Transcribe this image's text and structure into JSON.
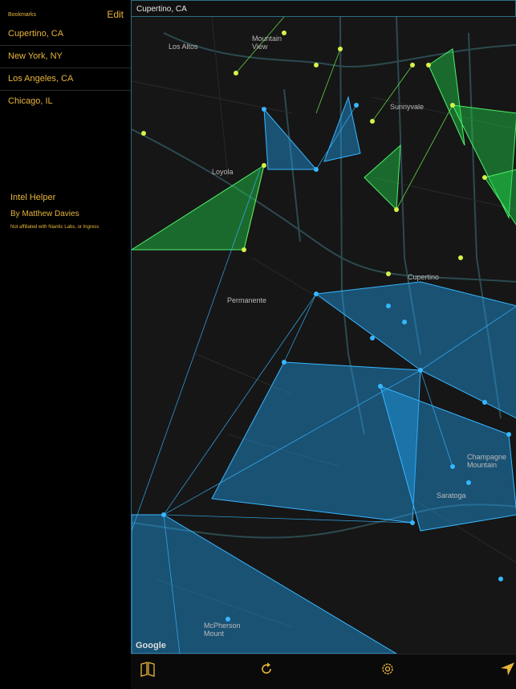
{
  "sidebar": {
    "title": "Bookmarks",
    "edit_label": "Edit",
    "bookmarks": [
      {
        "label": "Cupertino, CA"
      },
      {
        "label": "New York, NY"
      },
      {
        "label": "Los Angeles, CA"
      },
      {
        "label": "Chicago, IL"
      }
    ],
    "app_name": "Intel Helper",
    "author": "By Matthew Davies",
    "disclaimer": "Not affiliated with Niantic Labs, or Ingress"
  },
  "search": {
    "value": "Cupertino, CA"
  },
  "map": {
    "attribution": "Google",
    "place_labels": [
      {
        "text": "Mountain View"
      },
      {
        "text": "Los Altos"
      },
      {
        "text": "Sunnyvale"
      },
      {
        "text": "Loyola"
      },
      {
        "text": "Cupertino"
      },
      {
        "text": "Permanente"
      },
      {
        "text": "Champagne Mountain"
      },
      {
        "text": "Saratoga"
      },
      {
        "text": "McPherson Mount"
      }
    ],
    "colors": {
      "resistance": "#1e9be6",
      "enlightened": "#22d14a",
      "portal_neutral": "#d6f24a",
      "background": "#161616"
    }
  },
  "toolbar": {
    "icons": [
      "bookmarks-icon",
      "refresh-icon",
      "settings-icon",
      "location-arrow-icon"
    ]
  },
  "accent_color": "#e8b53a"
}
